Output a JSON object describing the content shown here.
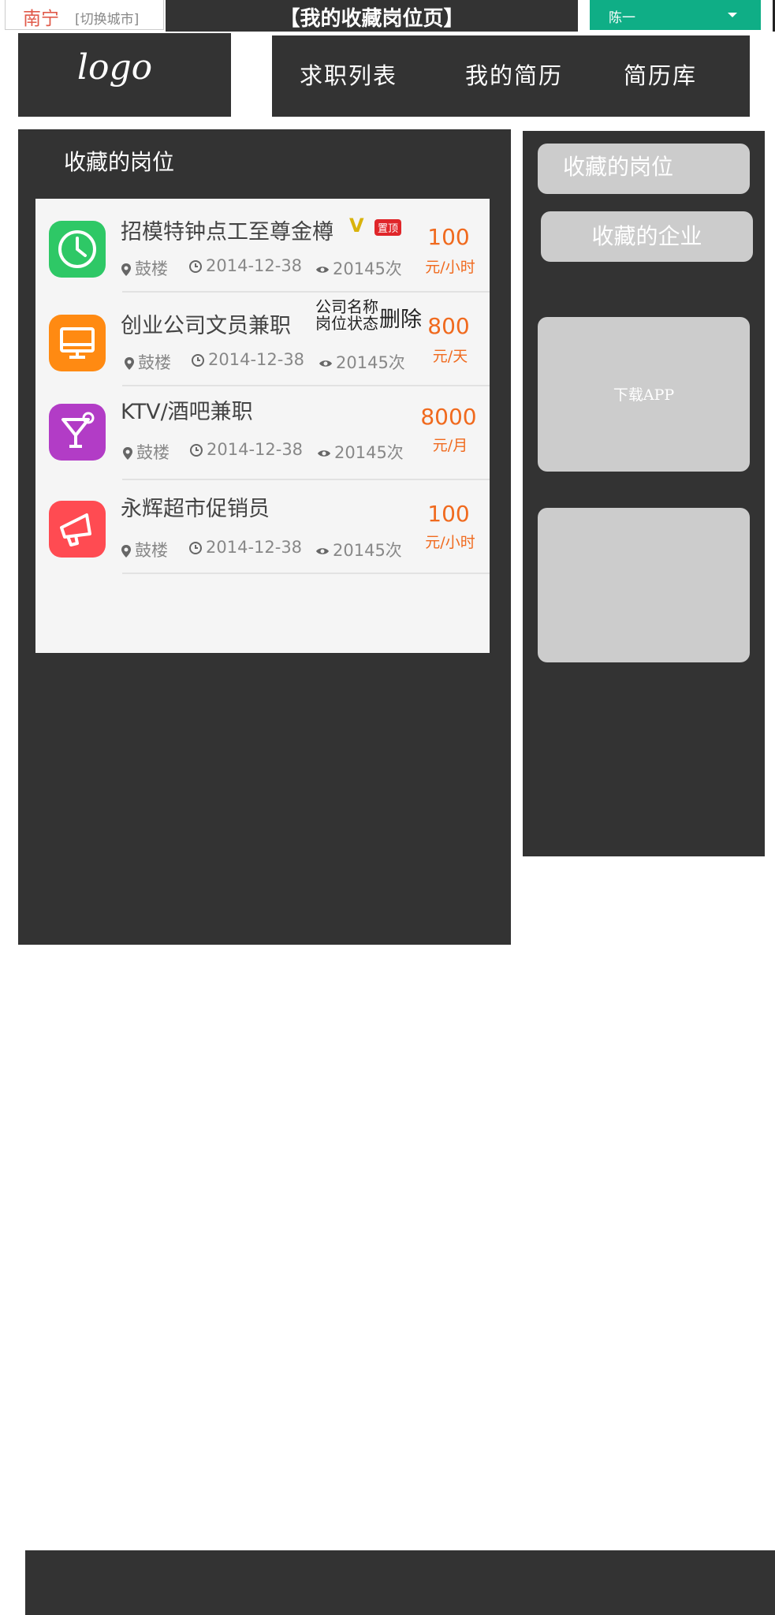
{
  "topbar": {
    "city": "南宁",
    "switch_city": "[切换城市]",
    "page_title": "【我的收藏岗位页】",
    "user": "陈一"
  },
  "header": {
    "logo": "logo",
    "nav": [
      "求职列表",
      "我的简历",
      "简历库"
    ]
  },
  "main": {
    "heading": "收藏的岗位",
    "jobs": [
      {
        "title": "招模特钟点工至尊金樽",
        "location": "鼓楼",
        "date": "2014-12-38",
        "views": "20145次",
        "pay": "100",
        "unit": "元/小时",
        "badge_v": "V",
        "badge_top": "置顶",
        "icon": "clock-icon",
        "color": "#2ec866"
      },
      {
        "title": "创业公司文员兼职",
        "location": "鼓楼",
        "date": "2014-12-38",
        "views": "20145次",
        "pay": "800",
        "unit": "元/天",
        "icon": "monitor-icon",
        "color": "#ff8a12",
        "overlay_company": "公司名称",
        "overlay_status": "岗位状态",
        "overlay_delete": "删除"
      },
      {
        "title": "KTV/酒吧兼职",
        "location": "鼓楼",
        "date": "2014-12-38",
        "views": "20145次",
        "pay": "8000",
        "unit": "元/月",
        "icon": "cocktail-icon",
        "color": "#b23cc6"
      },
      {
        "title": "永辉超市促销员",
        "location": "鼓楼",
        "date": "2014-12-38",
        "views": "20145次",
        "pay": "100",
        "unit": "元/小时",
        "icon": "megaphone-icon",
        "color": "#ff4b52"
      }
    ]
  },
  "sidebar": {
    "fav_jobs": "收藏的岗位",
    "fav_companies": "收藏的企业",
    "download_app": "下载APP"
  }
}
